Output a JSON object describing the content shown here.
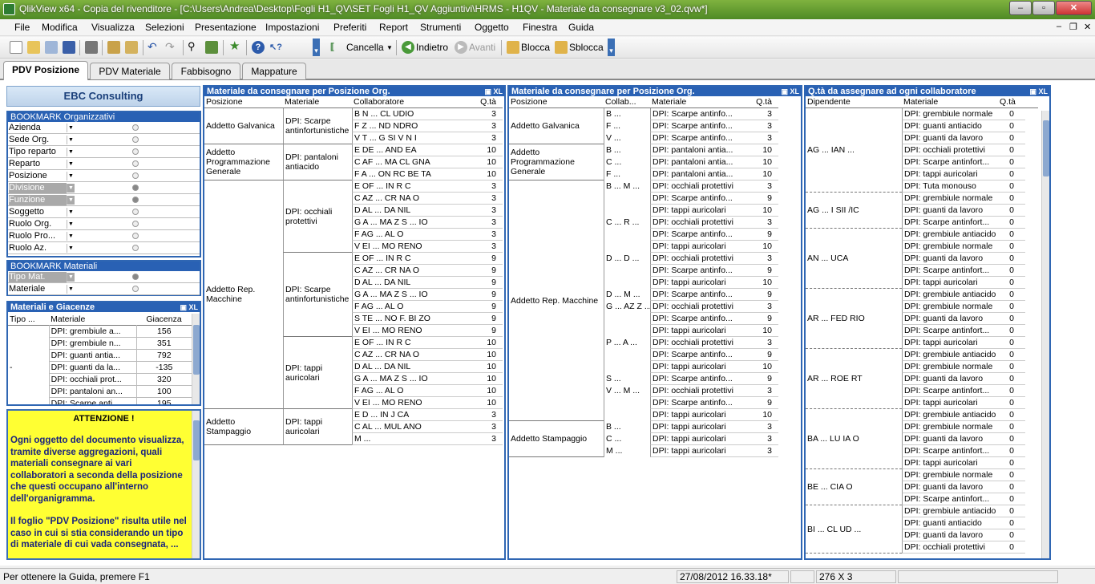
{
  "titlebar": {
    "title": "QlikView x64 - Copia del rivenditore - [C:\\Users\\Andrea\\Desktop\\Fogli H1_QV\\SET Fogli  H1_QV Aggiuntivi\\HRMS - H1QV - Materiale da consegnare v3_02.qvw*]"
  },
  "menu": [
    "File",
    "Modifica",
    "Visualizza",
    "Selezioni",
    "Presentazione",
    "Impostazioni",
    "Preferiti",
    "Report",
    "Strumenti",
    "Oggetto",
    "Finestra",
    "Guida"
  ],
  "toolbar": {
    "cancella": "Cancella",
    "indietro": "Indietro",
    "avanti": "Avanti",
    "blocca": "Blocca",
    "sblocca": "Sblocca"
  },
  "tabs": [
    "PDV Posizione",
    "PDV Materiale",
    "Fabbisogno",
    "Mappature"
  ],
  "sidebar": {
    "company": "EBC Consulting",
    "bm_org_title": "BOOKMARK Organizzativi",
    "bm_org": [
      "Azienda",
      "Sede Org.",
      "Tipo reparto",
      "Reparto",
      "Posizione",
      "Divisione",
      "Funzione",
      "Soggetto",
      "Ruolo Org.",
      "Ruolo Pro...",
      "Ruolo Az."
    ],
    "bm_mat_title": "BOOKMARK Materiali",
    "bm_mat": [
      "Tipo Mat.",
      "Materiale"
    ],
    "giac_title": "Materiali e Giacenze",
    "giac_cols": [
      "Tipo ...",
      "Materiale",
      "Giacenza"
    ],
    "giac_tipo": "-",
    "giac_rows": [
      [
        "DPI: grembiule a...",
        "156"
      ],
      [
        "DPI: grembiule n...",
        "351"
      ],
      [
        "DPI: guanti antia...",
        "792"
      ],
      [
        "DPI: guanti da la...",
        "-135"
      ],
      [
        "DPI: occhiali prot...",
        "320"
      ],
      [
        "DPI: pantaloni an...",
        "100"
      ],
      [
        "DPI: Scarpe anti...",
        "195"
      ]
    ],
    "note_title": "ATTENZIONE !",
    "note_p1": "Ogni oggetto del documento visualizza, tramite diverse aggregazioni, quali materiali consegnare ai vari collaboratori a seconda della posizione che questi occupano all'interno dell'organigramma.",
    "note_p2": "Il foglio \"PDV Posizione\" risulta utile nel caso in cui si stia considerando un tipo di materiale di cui vada consegnata, ..."
  },
  "panel1": {
    "title": "Materiale da consegnare per Posizione Org.",
    "cols": [
      "Posizione",
      "Materiale",
      "Collaboratore",
      "Q.tà"
    ],
    "groups": [
      {
        "pos": "Addetto Galvanica",
        "mats": [
          {
            "mat": "DPI: Scarpe antinfortunistiche",
            "rows": [
              [
                "B N ... CL UDIO",
                "3"
              ],
              [
                "F Z ... ND NDRO",
                "3"
              ],
              [
                "V T ... G SI V N I",
                "3"
              ]
            ]
          }
        ]
      },
      {
        "pos": "Addetto Programmazione Generale",
        "mats": [
          {
            "mat": "DPI: pantaloni antiacido",
            "rows": [
              [
                "E DE ... AND EA",
                "10"
              ],
              [
                "C AF ... MA CL GNA",
                "10"
              ],
              [
                "F A ... ON RC BE TA",
                "10"
              ]
            ]
          }
        ]
      },
      {
        "pos": "Addetto Rep. Macchine",
        "mats": [
          {
            "mat": "DPI: occhiali protettivi",
            "rows": [
              [
                "E OF ... IN R C",
                "3"
              ],
              [
                "C AZ ... CR NA O",
                "3"
              ],
              [
                "D AL ... DA NIL",
                "3"
              ],
              [
                "G A ... MA Z S ... IO",
                "3"
              ],
              [
                "F AG ... AL O",
                "3"
              ],
              [
                "V EI ... MO RENO",
                "3"
              ]
            ]
          },
          {
            "mat": "DPI: Scarpe antinfortunistiche",
            "rows": [
              [
                "E OF ... IN R C",
                "9"
              ],
              [
                "C AZ ... CR NA O",
                "9"
              ],
              [
                "D AL ... DA NIL",
                "9"
              ],
              [
                "G A ... MA Z S ... IO",
                "9"
              ],
              [
                "F AG ... AL O",
                "9"
              ],
              [
                "S TE ... NO F. BI ZO",
                "9"
              ],
              [
                "V EI ... MO RENO",
                "9"
              ]
            ]
          },
          {
            "mat": "DPI: tappi auricolari",
            "rows": [
              [
                "E OF ... IN R C",
                "10"
              ],
              [
                "C AZ ... CR NA O",
                "10"
              ],
              [
                "D AL ... DA NIL",
                "10"
              ],
              [
                "G A ... MA Z S ... IO",
                "10"
              ],
              [
                "F AG ... AL O",
                "10"
              ],
              [
                "V EI ... MO RENO",
                "10"
              ]
            ]
          }
        ]
      },
      {
        "pos": "Addetto Stampaggio",
        "mats": [
          {
            "mat": "DPI: tappi auricolari",
            "rows": [
              [
                "E D ... IN J CA",
                "3"
              ],
              [
                "C AL ... MUL ANO",
                "3"
              ],
              [
                "M ...",
                "3"
              ]
            ]
          }
        ]
      }
    ]
  },
  "panel2": {
    "title": "Materiale da consegnare per Posizione Org.",
    "cols": [
      "Posizione",
      "Collab...",
      "Materiale",
      "Q.tà"
    ],
    "groups": [
      {
        "pos": "Addetto Galvanica",
        "rows": [
          [
            "B ...",
            "DPI: Scarpe antinfo...",
            "3"
          ],
          [
            "F ...",
            "DPI: Scarpe antinfo...",
            "3"
          ],
          [
            "V ...",
            "DPI: Scarpe antinfo...",
            "3"
          ]
        ]
      },
      {
        "pos": "Addetto Programmazione Generale",
        "rows": [
          [
            "B ...",
            "DPI: pantaloni antia...",
            "10"
          ],
          [
            "C ...",
            "DPI: pantaloni antia...",
            "10"
          ],
          [
            "F ...",
            "DPI: pantaloni antia...",
            "10"
          ]
        ]
      },
      {
        "pos": "Addetto Rep. Macchine",
        "rows": [
          [
            "B ... M ...",
            "DPI: occhiali protettivi",
            "3"
          ],
          [
            "",
            "DPI: Scarpe antinfo...",
            "9"
          ],
          [
            "",
            "DPI: tappi auricolari",
            "10"
          ],
          [
            "C ... R ...",
            "DPI: occhiali protettivi",
            "3"
          ],
          [
            "",
            "DPI: Scarpe antinfo...",
            "9"
          ],
          [
            "",
            "DPI: tappi auricolari",
            "10"
          ],
          [
            "D ... D ...",
            "DPI: occhiali protettivi",
            "3"
          ],
          [
            "",
            "DPI: Scarpe antinfo...",
            "9"
          ],
          [
            "",
            "DPI: tappi auricolari",
            "10"
          ],
          [
            "D ... M ...",
            "DPI: Scarpe antinfo...",
            "9"
          ],
          [
            "G ... AZ Z ...",
            "DPI: occhiali protettivi",
            "3"
          ],
          [
            "",
            "DPI: Scarpe antinfo...",
            "9"
          ],
          [
            "",
            "DPI: tappi auricolari",
            "10"
          ],
          [
            "P ... A ...",
            "DPI: occhiali protettivi",
            "3"
          ],
          [
            "",
            "DPI: Scarpe antinfo...",
            "9"
          ],
          [
            "",
            "DPI: tappi auricolari",
            "10"
          ],
          [
            "S ...",
            "DPI: Scarpe antinfo...",
            "9"
          ],
          [
            "V ... M ...",
            "DPI: occhiali protettivi",
            "3"
          ],
          [
            "",
            "DPI: Scarpe antinfo...",
            "9"
          ],
          [
            "",
            "DPI: tappi auricolari",
            "10"
          ]
        ]
      },
      {
        "pos": "Addetto Stampaggio",
        "rows": [
          [
            "B ...",
            "DPI: tappi auricolari",
            "3"
          ],
          [
            "C ...",
            "DPI: tappi auricolari",
            "3"
          ],
          [
            "M ...",
            "DPI: tappi auricolari",
            "3"
          ]
        ]
      }
    ]
  },
  "panel3": {
    "title": "Q.tà da assegnare ad ogni collaboratore",
    "cols": [
      "Dipendente",
      "Materiale",
      "Q.tà"
    ],
    "groups": [
      {
        "dip": "AG ... IAN ...",
        "rows": [
          [
            "DPI: grembiule normale",
            "0"
          ],
          [
            "DPI: guanti antiacido",
            "0"
          ],
          [
            "DPI: guanti da lavoro",
            "0"
          ],
          [
            "DPI: occhiali protettivi",
            "0"
          ],
          [
            "DPI: Scarpe antinfort...",
            "0"
          ],
          [
            "DPI: tappi auricolari",
            "0"
          ],
          [
            "DPI: Tuta monouso",
            "0"
          ]
        ]
      },
      {
        "dip": "AG ... I SII /IC",
        "rows": [
          [
            "DPI: grembiule normale",
            "0"
          ],
          [
            "DPI: guanti da lavoro",
            "0"
          ],
          [
            "DPI: Scarpe antinfort...",
            "0"
          ]
        ]
      },
      {
        "dip": "AN ... UCA",
        "rows": [
          [
            "DPI: grembiule antiacido",
            "0"
          ],
          [
            "DPI: grembiule normale",
            "0"
          ],
          [
            "DPI: guanti da lavoro",
            "0"
          ],
          [
            "DPI: Scarpe antinfort...",
            "0"
          ],
          [
            "DPI: tappi auricolari",
            "0"
          ]
        ]
      },
      {
        "dip": "AR ... FED RIO",
        "rows": [
          [
            "DPI: grembiule antiacido",
            "0"
          ],
          [
            "DPI: grembiule normale",
            "0"
          ],
          [
            "DPI: guanti da lavoro",
            "0"
          ],
          [
            "DPI: Scarpe antinfort...",
            "0"
          ],
          [
            "DPI: tappi auricolari",
            "0"
          ]
        ]
      },
      {
        "dip": "AR ... ROE RT",
        "rows": [
          [
            "DPI: grembiule antiacido",
            "0"
          ],
          [
            "DPI: grembiule normale",
            "0"
          ],
          [
            "DPI: guanti da lavoro",
            "0"
          ],
          [
            "DPI: Scarpe antinfort...",
            "0"
          ],
          [
            "DPI: tappi auricolari",
            "0"
          ]
        ]
      },
      {
        "dip": "BA ... LU IA O",
        "rows": [
          [
            "DPI: grembiule antiacido",
            "0"
          ],
          [
            "DPI: grembiule normale",
            "0"
          ],
          [
            "DPI: guanti da lavoro",
            "0"
          ],
          [
            "DPI: Scarpe antinfort...",
            "0"
          ],
          [
            "DPI: tappi auricolari",
            "0"
          ]
        ]
      },
      {
        "dip": "BE ... CIA O",
        "rows": [
          [
            "DPI: grembiule normale",
            "0"
          ],
          [
            "DPI: guanti da lavoro",
            "0"
          ],
          [
            "DPI: Scarpe antinfort...",
            "0"
          ]
        ]
      },
      {
        "dip": "BI ... CL UD ...",
        "rows": [
          [
            "DPI: grembiule antiacido",
            "0"
          ],
          [
            "DPI: guanti antiacido",
            "0"
          ],
          [
            "DPI: guanti da lavoro",
            "0"
          ],
          [
            "DPI: occhiali protettivi",
            "0"
          ]
        ]
      }
    ]
  },
  "status": {
    "help": "Per ottenere la Guida, premere F1",
    "datetime": "27/08/2012 16.33.18*",
    "dims": "276 X 3"
  }
}
